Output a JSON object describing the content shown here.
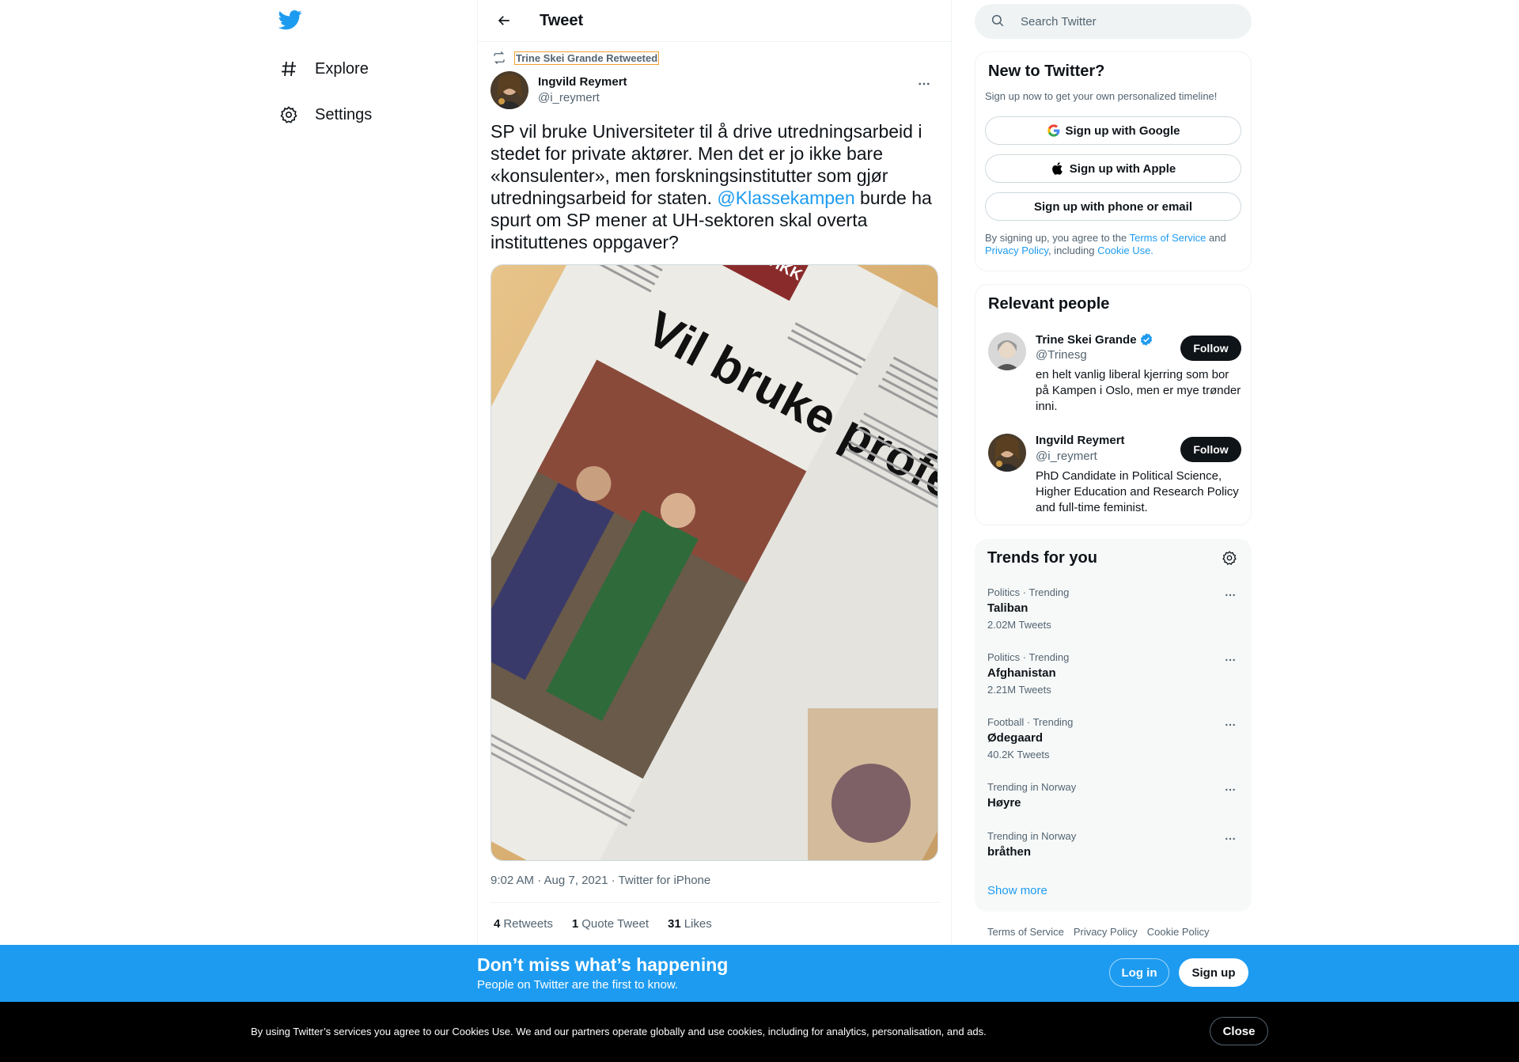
{
  "nav": {
    "explore_label": "Explore",
    "settings_label": "Settings"
  },
  "header": {
    "title": "Tweet"
  },
  "tweet": {
    "retweeted_by": "Trine Skei Grande Retweeted",
    "author_name": "Ingvild Reymert",
    "author_handle": "@i_reymert",
    "text_before": "SP vil bruke Universiteter til å drive utredningsarbeid i stedet for private aktører. Men det er jo ikke bare «konsulenter», men forskningsinstitutter som gjør utredningsarbeid for staten. ",
    "mention": "@Klassekampen",
    "text_after": " burde ha spurt om SP mener at UH-sektoren skal overta instituttenes oppgaver?",
    "timestamp": "9:02 AM · Aug 7, 2021 · Twitter for iPhone",
    "image_headline": "Vil bruke professorane",
    "image_section": "POLITIKK",
    "retweets_count": "4",
    "retweets_label": "Retweets",
    "quotes_count": "1",
    "quotes_label": "Quote Tweet",
    "likes_count": "31",
    "likes_label": "Likes"
  },
  "search": {
    "placeholder": "Search Twitter"
  },
  "new_to_twitter": {
    "title": "New to Twitter?",
    "subtitle": "Sign up now to get your own personalized timeline!",
    "google_label": "Sign up with Google",
    "apple_label": "Sign up with Apple",
    "phone_label": "Sign up with phone or email",
    "legal_1": "By signing up, you agree to the ",
    "terms": "Terms of Service",
    "legal_2": " and ",
    "privacy": "Privacy Policy",
    "legal_3": ", including ",
    "cookie": "Cookie Use."
  },
  "relevant": {
    "title": "Relevant people",
    "people": [
      {
        "name": "Trine Skei Grande",
        "handle": "@Trinesg",
        "bio": "en helt vanlig liberal kjerring som bor på Kampen i Oslo, men er mye trønder inni.",
        "follow": "Follow"
      },
      {
        "name": "Ingvild Reymert",
        "handle": "@i_reymert",
        "bio": "PhD Candidate in Political Science, Higher Education and Research Policy and full-time feminist.",
        "follow": "Follow"
      }
    ]
  },
  "trends": {
    "title": "Trends for you",
    "items": [
      {
        "meta": "Politics · Trending",
        "name": "Taliban",
        "count": "2.02M Tweets"
      },
      {
        "meta": "Politics · Trending",
        "name": "Afghanistan",
        "count": "2.21M Tweets"
      },
      {
        "meta": "Football · Trending",
        "name": "Ødegaard",
        "count": "40.2K Tweets"
      },
      {
        "meta": "Trending in Norway",
        "name": "Høyre",
        "count": ""
      },
      {
        "meta": "Trending in Norway",
        "name": "bråthen",
        "count": ""
      }
    ],
    "show_more": "Show more"
  },
  "footer": {
    "terms": "Terms of Service",
    "privacy": "Privacy Policy",
    "cookie": "Cookie Policy"
  },
  "bottom_bar": {
    "title": "Don’t miss what’s happening",
    "subtitle": "People on Twitter are the first to know.",
    "login": "Log in",
    "signup": "Sign up"
  },
  "cookie_bar": {
    "text": "By using Twitter’s services you agree to our Cookies Use. We and our partners operate globally and use cookies, including for analytics, personalisation, and ads.",
    "close": "Close"
  },
  "colors": {
    "accent": "#1d9bf0",
    "text": "#0f1419",
    "muted": "#536471"
  }
}
